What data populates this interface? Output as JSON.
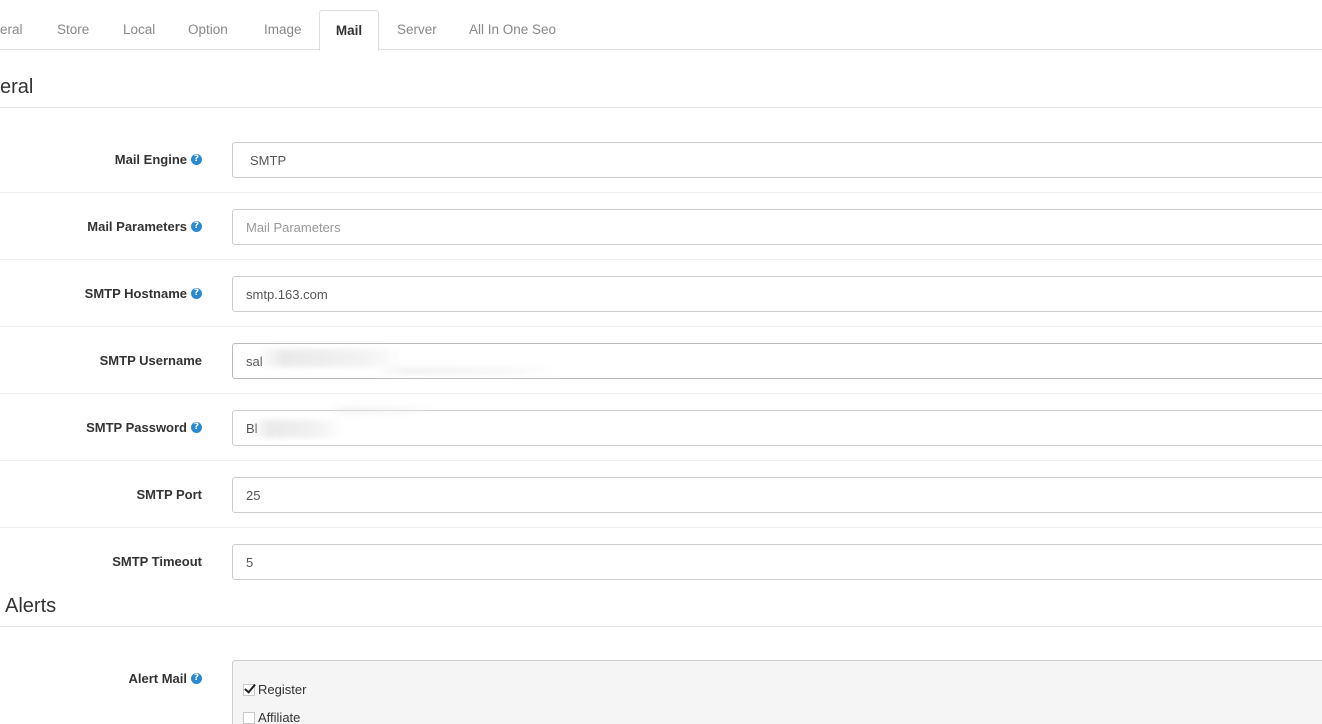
{
  "tabs": [
    {
      "label": "eral",
      "active": false
    },
    {
      "label": "Store",
      "active": false
    },
    {
      "label": "Local",
      "active": false
    },
    {
      "label": "Option",
      "active": false
    },
    {
      "label": "Image",
      "active": false
    },
    {
      "label": "Mail",
      "active": true
    },
    {
      "label": "Server",
      "active": false
    },
    {
      "label": "All In One Seo",
      "active": false
    }
  ],
  "sections": {
    "general": "eral",
    "alerts": "Alerts"
  },
  "fields": {
    "mail_engine": {
      "label": "Mail Engine",
      "value": "SMTP"
    },
    "mail_parameters": {
      "label": "Mail Parameters",
      "value": "",
      "placeholder": "Mail Parameters"
    },
    "smtp_hostname": {
      "label": "SMTP Hostname",
      "value": "smtp.163.com"
    },
    "smtp_username": {
      "label": "SMTP Username",
      "value": "sal"
    },
    "smtp_password": {
      "label": "SMTP Password",
      "value": "Bl"
    },
    "smtp_port": {
      "label": "SMTP Port",
      "value": "25"
    },
    "smtp_timeout": {
      "label": "SMTP Timeout",
      "value": "5"
    }
  },
  "alert_mail": {
    "label": "Alert Mail",
    "options": [
      {
        "label": "Register",
        "checked": true
      },
      {
        "label": "Affiliate",
        "checked": false
      }
    ]
  },
  "icons": {
    "help": "question-circle-icon",
    "help_glyph": "?"
  },
  "colors": {
    "help_icon": "#2a8ad1",
    "border": "#cccccc",
    "tab_border": "#dddddd"
  }
}
